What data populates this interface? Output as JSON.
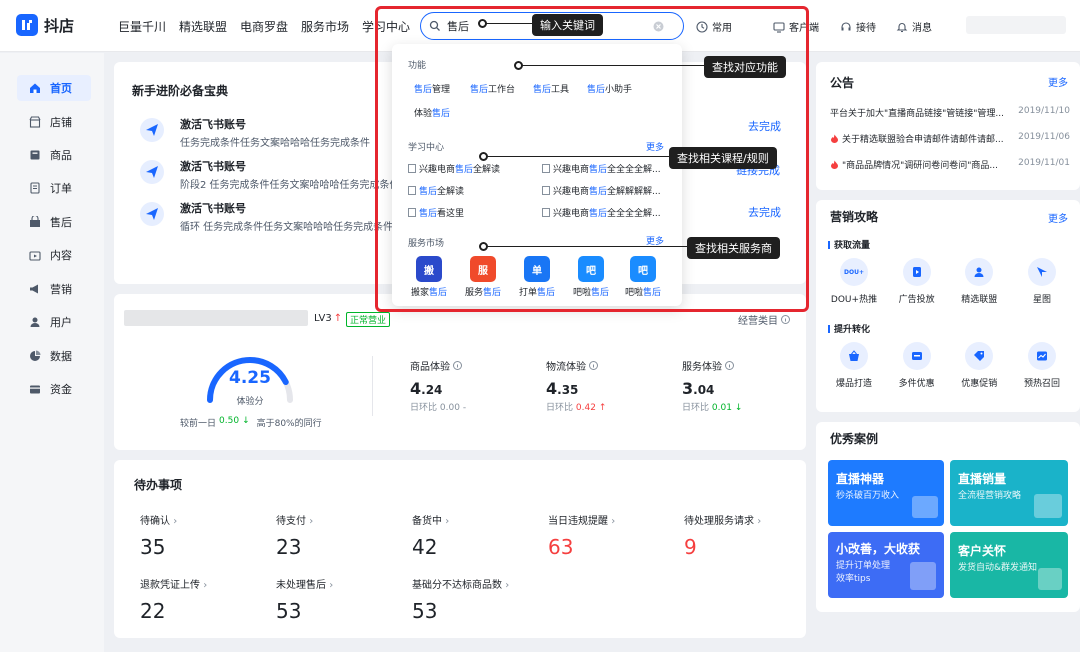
{
  "app": {
    "logo_text": "抖店"
  },
  "topnav": [
    "巨量千川",
    "精选联盟",
    "电商罗盘",
    "服务市场",
    "学习中心"
  ],
  "search": {
    "value": "售后"
  },
  "toolbar": {
    "common": "常用",
    "service": "客户端",
    "reception": "接待",
    "messages": "消息"
  },
  "sidebar": {
    "items": [
      {
        "label": "首页",
        "icon": "home-icon"
      },
      {
        "label": "店铺",
        "icon": "store-icon"
      },
      {
        "label": "商品",
        "icon": "product-icon"
      },
      {
        "label": "订单",
        "icon": "order-icon"
      },
      {
        "label": "售后",
        "icon": "after-sale-icon"
      },
      {
        "label": "内容",
        "icon": "content-icon"
      },
      {
        "label": "营销",
        "icon": "megaphone-icon"
      },
      {
        "label": "用户",
        "icon": "user-icon"
      },
      {
        "label": "数据",
        "icon": "pie-chart-icon"
      },
      {
        "label": "资金",
        "icon": "wallet-icon"
      }
    ]
  },
  "guide": {
    "title": "新手进阶必备宝典",
    "tasks": [
      {
        "title": "激活飞书账号",
        "desc": "任务完成条件任务文案哈哈哈任务完成条件",
        "action": "去完成"
      },
      {
        "title": "激活飞书账号",
        "desc": "阶段2 任务完成条件任务文案哈哈哈任务完成条件",
        "action": "链接完成"
      },
      {
        "title": "激活飞书账号",
        "desc": "循环 任务完成条件任务文案哈哈哈任务完成条件",
        "action": "去完成"
      }
    ]
  },
  "experience": {
    "level": "LV3",
    "status": "正常营业",
    "manage_link": "经营类目",
    "score": "4.25",
    "score_label": "体验分",
    "score_fill": 0.85,
    "compare_prev_label": "较前一日",
    "compare_prev": "0.50",
    "compare_peer": "高于80%的同行",
    "metrics": [
      {
        "label": "商品体验",
        "int": "4",
        "dec": ".24",
        "sub_label": "日环比",
        "sub_val": "0.00",
        "trend": "flat"
      },
      {
        "label": "物流体验",
        "int": "4",
        "dec": ".35",
        "sub_label": "日环比",
        "sub_val": "0.42",
        "trend": "up"
      },
      {
        "label": "服务体验",
        "int": "3",
        "dec": ".04",
        "sub_label": "日环比",
        "sub_val": "0.01",
        "trend": "down"
      }
    ]
  },
  "todo": {
    "title": "待办事项",
    "items": [
      {
        "label": "待确认",
        "value": "35",
        "color": "#1f2329"
      },
      {
        "label": "待支付",
        "value": "23",
        "color": "#1f2329"
      },
      {
        "label": "备货中",
        "value": "42",
        "color": "#1f2329"
      },
      {
        "label": "当日违规提醒",
        "value": "63",
        "color": "#f53f3f"
      },
      {
        "label": "待处理服务请求",
        "value": "9",
        "color": "#f53f3f"
      },
      {
        "label": "退款凭证上传",
        "value": "22",
        "color": "#1f2329"
      },
      {
        "label": "未处理售后",
        "value": "53",
        "color": "#1f2329"
      },
      {
        "label": "基础分不达标商品数",
        "value": "53",
        "color": "#1f2329"
      }
    ]
  },
  "notice": {
    "title": "公告",
    "more": "更多",
    "items": [
      {
        "text": "平台关于加大\"直播商品链接\"管链接\"管理...",
        "date": "2019/11/10",
        "hot": false
      },
      {
        "text": "关于精选联盟验合申请邮件请邮件请邮...",
        "date": "2019/11/06",
        "hot": true
      },
      {
        "text": "\"商品品牌情况\"调研问卷问卷问\"商品...",
        "date": "2019/11/01",
        "hot": true
      }
    ]
  },
  "marketing": {
    "title": "营销攻略",
    "more": "更多",
    "groups": [
      {
        "name": "获取流量",
        "items": [
          {
            "label": "DOU+热推",
            "icon": "dou-plus-icon"
          },
          {
            "label": "广告投放",
            "icon": "ad-icon"
          },
          {
            "label": "精选联盟",
            "icon": "alliance-icon"
          },
          {
            "label": "星图",
            "icon": "star-map-icon"
          }
        ]
      },
      {
        "name": "提升转化",
        "items": [
          {
            "label": "爆品打造",
            "icon": "basket-icon"
          },
          {
            "label": "多件优惠",
            "icon": "multi-discount-icon"
          },
          {
            "label": "优惠促销",
            "icon": "coupon-icon"
          },
          {
            "label": "预热召回",
            "icon": "trend-icon"
          }
        ]
      }
    ]
  },
  "cases": {
    "title": "优秀案例",
    "items": [
      {
        "title": "直播神器",
        "sub": "秒杀破百万收入",
        "color": "#1e7bff"
      },
      {
        "title": "直播销量",
        "sub": "全流程营销攻略",
        "color": "#1ab3c9"
      },
      {
        "title": "小改善，大收获",
        "sub": "提升订单处理效率tips",
        "color": "#3d6cf5"
      },
      {
        "title": "客户关怀",
        "sub": "发货自动&群发通知",
        "color": "#19b7a5"
      }
    ]
  },
  "dropdown": {
    "functions_label": "功能",
    "functions": [
      {
        "pre": "售后",
        "post": "管理"
      },
      {
        "pre": "售后",
        "post": "工作台"
      },
      {
        "pre": "售后",
        "post": "工具"
      },
      {
        "pre": "售后",
        "post": "小助手"
      },
      {
        "pre": "体验",
        "post": "售后"
      }
    ],
    "learning_label": "学习中心",
    "learning_more": "更多",
    "courses": [
      {
        "a": "兴趣电商",
        "b": "售后",
        "c": "全解读"
      },
      {
        "a": "兴趣电商",
        "b": "售后",
        "c": "全全全全解..."
      },
      {
        "a": "",
        "b": "售后",
        "c": "全解读"
      },
      {
        "a": "兴趣电商",
        "b": "售后",
        "c": "全解解解解..."
      },
      {
        "a": "",
        "b": "售后",
        "c": "看这里"
      },
      {
        "a": "兴趣电商",
        "b": "售后",
        "c": "全全全全解..."
      }
    ],
    "market_label": "服务市场",
    "market_more": "更多",
    "services": [
      {
        "pre": "搬家",
        "post": "售后",
        "color": "#2b4acb",
        "glyph": "搬"
      },
      {
        "pre": "服务",
        "post": "售后",
        "color": "#f04a2b",
        "glyph": "服"
      },
      {
        "pre": "打单",
        "post": "售后",
        "color": "#1976f5",
        "glyph": "单"
      },
      {
        "pre": "吧啦",
        "post": "售后",
        "color": "#1a8cff",
        "glyph": "吧"
      },
      {
        "pre": "吧啦",
        "post": "售后",
        "color": "#1a8cff",
        "glyph": "吧"
      }
    ]
  },
  "annotations": {
    "input": "输入关键词",
    "function": "查找对应功能",
    "course": "查找相关课程/规则",
    "service": "查找相关服务商"
  }
}
